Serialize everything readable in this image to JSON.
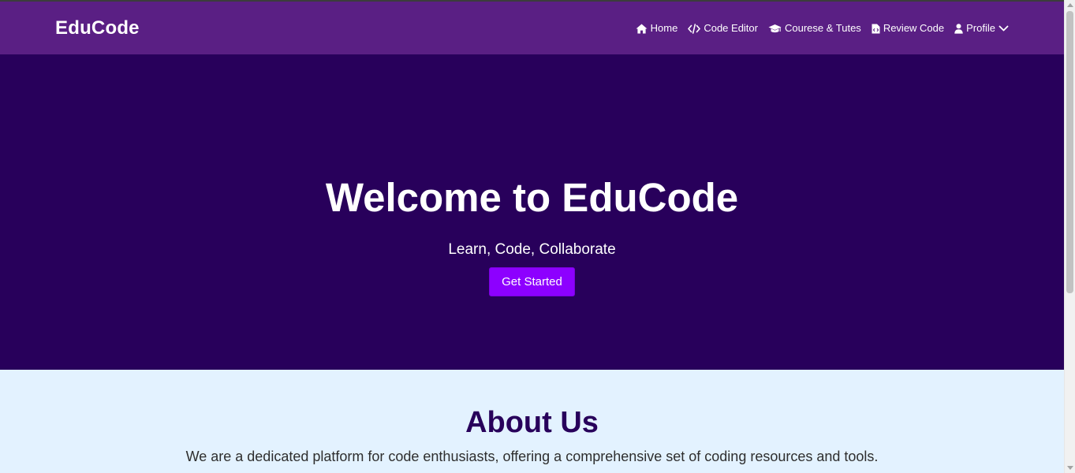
{
  "navbar": {
    "brand": "EduCode",
    "items": [
      {
        "label": "Home",
        "icon": "home-icon"
      },
      {
        "label": "Code Editor",
        "icon": "code-icon"
      },
      {
        "label": "Courese & Tutes",
        "icon": "graduation-cap-icon"
      },
      {
        "label": "Review Code",
        "icon": "file-code-icon"
      },
      {
        "label": "Profile",
        "icon": "user-icon",
        "dropdown_icon": "chevron-down-icon"
      }
    ]
  },
  "hero": {
    "title": "Welcome to EduCode",
    "subtitle": "Learn, Code, Collaborate",
    "cta_label": "Get Started"
  },
  "about": {
    "title": "About Us",
    "text": "We are a dedicated platform for code enthusiasts, offering a comprehensive set of coding resources and tools."
  },
  "colors": {
    "navbar_bg": "#5a1f84",
    "hero_bg": "#28005b",
    "cta_bg": "#8d00ff",
    "about_bg": "#e3f2ff",
    "about_title": "#28005b"
  }
}
